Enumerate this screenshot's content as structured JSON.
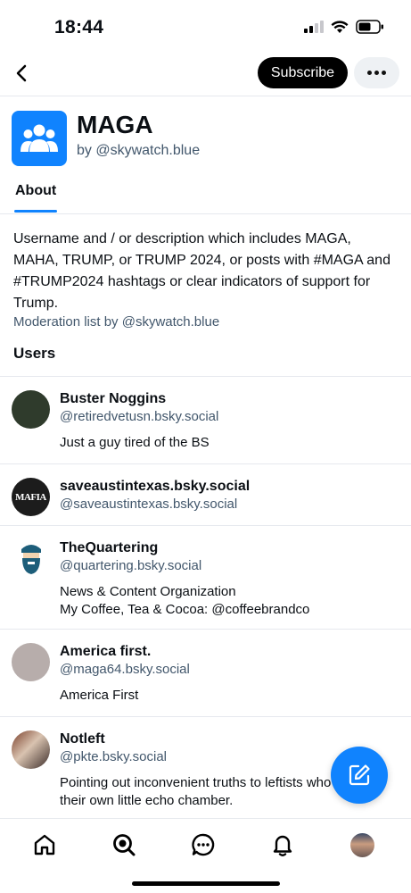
{
  "status_bar": {
    "time": "18:44"
  },
  "header": {
    "subscribe_label": "Subscribe"
  },
  "list": {
    "title": "MAGA",
    "by_prefix": "by",
    "by_handle": "@skywatch.blue",
    "avatar_color": "#1083fe"
  },
  "tabs": [
    {
      "label": "About",
      "active": true
    }
  ],
  "about": {
    "description": "Username and / or description which includes MAGA, MAHA, TRUMP, or TRUMP 2024, or posts with #MAGA and #TRUMP2024 hashtags or clear indicators of support for Trump.",
    "moderation": "Moderation list by @skywatch.blue",
    "users_heading": "Users"
  },
  "users": [
    {
      "name": "Buster Noggins",
      "handle": "@retiredvetusn.bsky.social",
      "bio_lines": [
        "Just a guy tired of the BS"
      ],
      "avatar": "dark-green-circle"
    },
    {
      "name": "saveaustintexas.bsky.social",
      "handle": "@saveaustintexas.bsky.social",
      "bio_lines": [],
      "avatar": "mafia-logo",
      "avatar_text": "MAFIA"
    },
    {
      "name": "TheQuartering",
      "handle": "@quartering.bsky.social",
      "bio_lines": [
        "News & Content Organization",
        "My Coffee, Tea & Cocoa: @coffeebrandco"
      ],
      "avatar": "bearded-man-logo"
    },
    {
      "name": "America first.",
      "handle": "@maga64.bsky.social",
      "bio_lines": [
        "America First"
      ],
      "avatar": "gray-circle"
    },
    {
      "name": "Notleft",
      "handle": "@pkte.bsky.social",
      "bio_lines": [
        "Pointing out inconvenient truths to leftists who live in",
        "their own little echo chamber."
      ],
      "avatar": "group-photo"
    }
  ],
  "colors": {
    "accent": "#1083fe",
    "muted_text": "#42576c",
    "divider": "#e6e9ee"
  },
  "bottom_nav": [
    "home-icon",
    "search-icon",
    "chat-icon",
    "bell-icon",
    "profile-avatar"
  ]
}
